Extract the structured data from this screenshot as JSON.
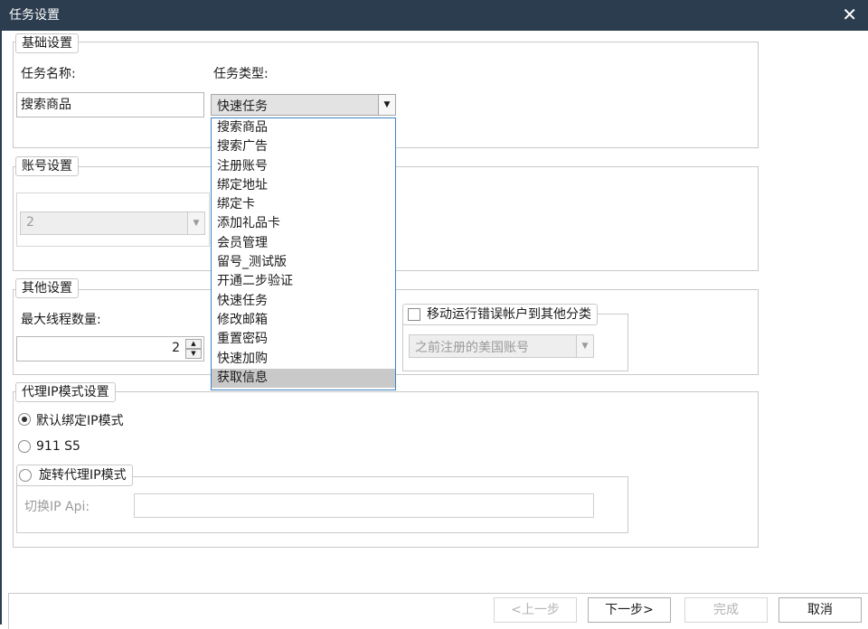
{
  "window": {
    "title": "任务设置",
    "close_glyph": "✕"
  },
  "basic": {
    "legend": "基础设置",
    "task_name_label": "任务名称:",
    "task_type_label": "任务类型:",
    "task_name_value": "搜索商品",
    "task_type_value": "快速任务",
    "task_type_options": [
      "搜索商品",
      "搜索广告",
      "注册账号",
      "绑定地址",
      "绑定卡",
      "添加礼品卡",
      "会员管理",
      "留号_测试版",
      "开通二步验证",
      "快速任务",
      "修改邮箱",
      "重置密码",
      "快速加购",
      "获取信息"
    ],
    "highlighted_option": "获取信息"
  },
  "account": {
    "legend": "账号设置",
    "combo_value": "2"
  },
  "other": {
    "legend": "其他设置",
    "max_threads_label": "最大线程数量:",
    "max_threads_value": "2",
    "move_error_label": "移动运行错误帐户到其他分类",
    "move_error_checked": false,
    "category_value": "之前注册的美国账号"
  },
  "proxy": {
    "legend": "代理IP模式设置",
    "option_default": "默认绑定IP模式",
    "option_911": "911 S5",
    "option_rotate": "旋转代理IP模式",
    "selected": "默认绑定IP模式",
    "switch_api_label": "切换IP Api:",
    "switch_api_value": ""
  },
  "footer": {
    "prev": "<上一步",
    "next": "下一步>",
    "finish": "完成",
    "cancel": "取消"
  },
  "icons": {
    "close": "close-icon",
    "dropdown": "chevron-down-icon",
    "spin_up": "spin-up-icon",
    "spin_down": "spin-down-icon"
  }
}
